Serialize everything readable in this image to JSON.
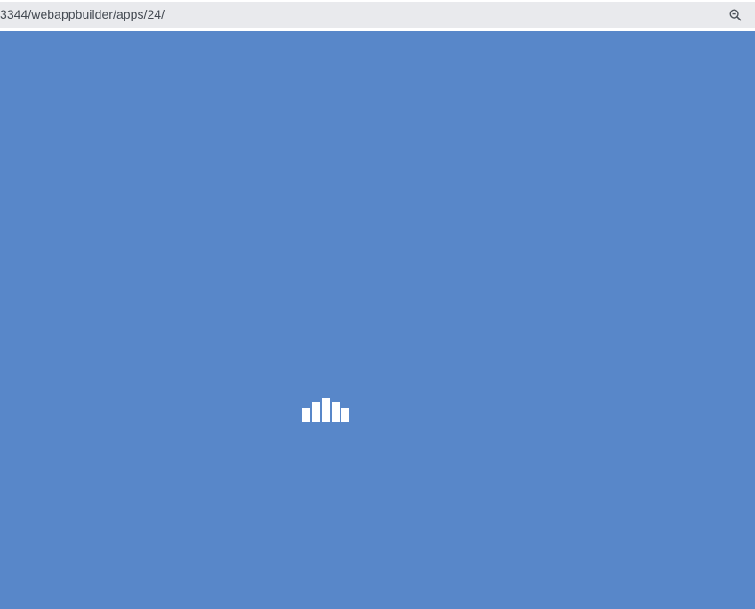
{
  "browser": {
    "url": "3344/webappbuilder/apps/24/",
    "zoom_icon": "zoom-out-icon"
  },
  "app": {
    "background_color": "#5887c9",
    "state": "loading",
    "loader": {
      "icon": "bars-loading-icon",
      "color": "#ffffff",
      "bar_levels": [
        0.6,
        0.84,
        1.0,
        0.84,
        0.6
      ]
    }
  }
}
